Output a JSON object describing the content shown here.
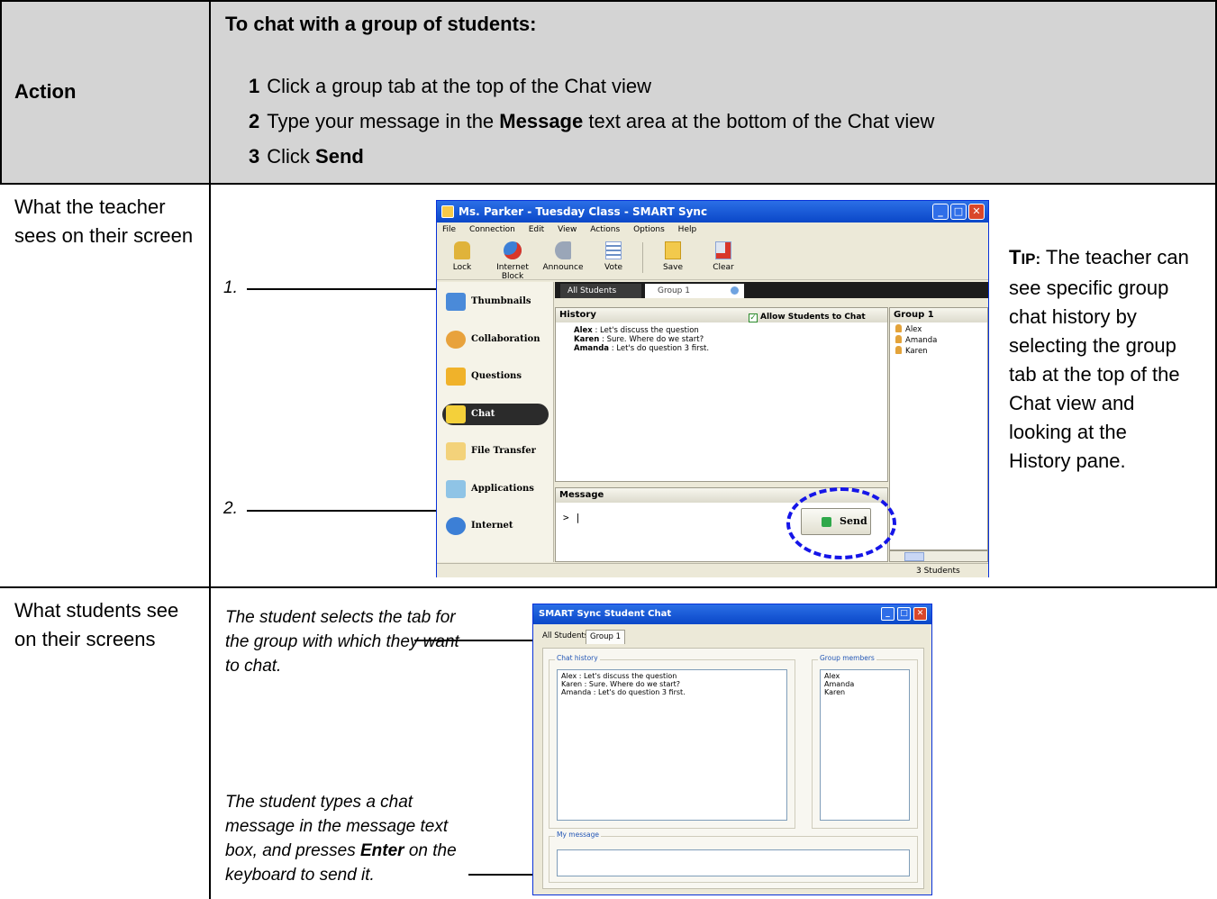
{
  "header": {
    "action_label": "Action",
    "title": "To chat with a group of students:",
    "steps": [
      {
        "num": "1",
        "before": "Click a group tab at the top of the Chat view",
        "bold": "",
        "after": ""
      },
      {
        "num": "2",
        "before": "Type your message in the ",
        "bold": "Message",
        "after": " text area at the bottom of the Chat view"
      },
      {
        "num": "3",
        "before": "Click ",
        "bold": "Send",
        "after": ""
      }
    ]
  },
  "rows": {
    "teacher_label": "What the teacher sees on their screen",
    "students_label": "What students see on their screens"
  },
  "pointers": {
    "one": "1.",
    "two": "2."
  },
  "tip": {
    "head_first": "T",
    "head_rest": "IP:",
    "body": " The teacher can see specific group chat history by selecting the group tab at the top of the Chat view and looking at the History pane."
  },
  "student_notes": {
    "tab_note": "The student selects the tab for the group with which they want to chat.",
    "msg_note_before": "The student types a chat message in the message text box, and presses ",
    "msg_note_bold": "Enter",
    "msg_note_after": " on the keyboard to send it."
  },
  "teacher_window": {
    "title": "Ms. Parker - Tuesday Class - SMART Sync",
    "menu": [
      "File",
      "Connection",
      "Edit",
      "View",
      "Actions",
      "Options",
      "Help"
    ],
    "tools": [
      "Lock",
      "Internet Block",
      "Announce",
      "Vote",
      "Save",
      "Clear"
    ],
    "nav": [
      "Thumbnails",
      "Collaboration",
      "Questions",
      "Chat",
      "File Transfer",
      "Applications",
      "Internet"
    ],
    "tabs": [
      "All Students",
      "Group 1"
    ],
    "history_label": "History",
    "allow_label": "Allow Students to Chat",
    "history": [
      {
        "who": "Alex",
        "text": " :  Let's discuss the question"
      },
      {
        "who": "Karen",
        "text": " :  Sure. Where do we start?"
      },
      {
        "who": "Amanda",
        "text": " :  Let's do question 3 first."
      }
    ],
    "group_label": "Group 1",
    "members": [
      "Alex",
      "Amanda",
      "Karen"
    ],
    "message_label": "Message",
    "prompt": "> |",
    "send_label": "Send",
    "status_count": "3 Students"
  },
  "student_window": {
    "title": "SMART Sync Student Chat",
    "tabs": [
      "All Students",
      "Group 1"
    ],
    "history_legend": "Chat history",
    "history": [
      "Alex  :  Let's discuss the question",
      "Karen  :  Sure. Where do we start?",
      "Amanda  :  Let's do question 3 first."
    ],
    "members_legend": "Group members",
    "members": [
      "Alex",
      "Amanda",
      "Karen"
    ],
    "message_legend": "My message"
  },
  "colors": {
    "header_bg": "#d4d4d4",
    "highlight_circle": "#1515e8",
    "titlebar": "#0a47c8"
  }
}
